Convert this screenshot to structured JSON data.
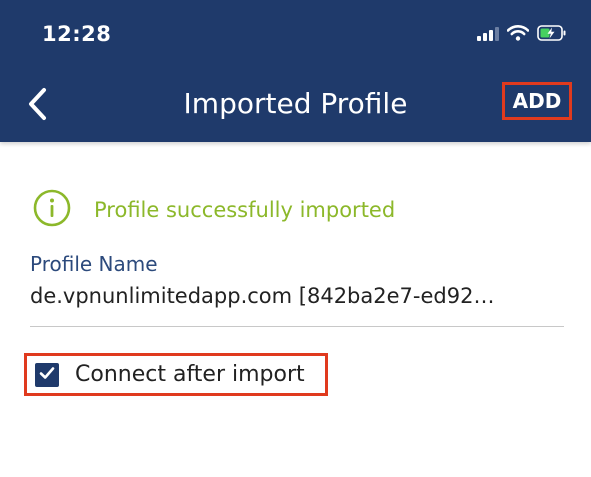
{
  "status_bar": {
    "time": "12:28",
    "icons": [
      "signal-icon",
      "wifi-icon",
      "battery-charging-icon"
    ]
  },
  "header": {
    "title": "Imported Profile",
    "back_icon": "chevron-left-icon",
    "add_label": "ADD"
  },
  "notice": {
    "icon": "info-circle-icon",
    "text": "Profile successfully imported",
    "color": "#8cb82a"
  },
  "profile_name": {
    "label": "Profile Name",
    "value": "de.vpnunlimitedapp.com [842ba2e7-ed92…"
  },
  "connect_after_import": {
    "label": "Connect after import",
    "checked": true
  },
  "colors": {
    "header_bg": "#1f3a6b",
    "highlight": "#e03a1e",
    "label": "#2c4a7c"
  }
}
